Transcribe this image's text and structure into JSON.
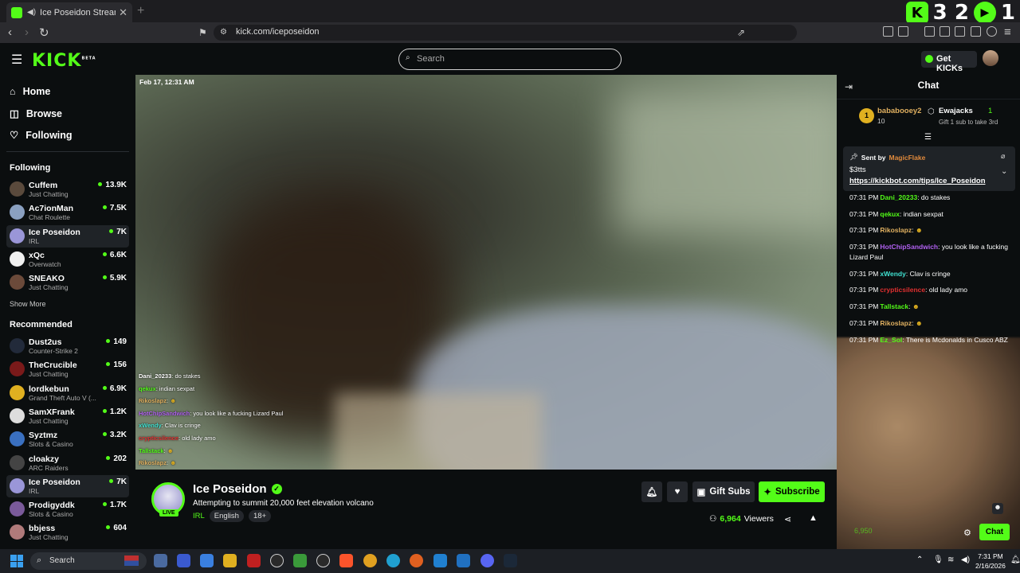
{
  "browser": {
    "tab_title": "Ice Poseidon Stream - Watch",
    "url": "kick.com/iceposeidon",
    "overlay": {
      "left_count": "3 2",
      "right_count": "1"
    }
  },
  "header": {
    "logo": "KICK",
    "logo_badge": "BETA",
    "search_placeholder": "Search",
    "get_kicks": "Get KICKs"
  },
  "sidebar": {
    "nav": [
      {
        "label": "Home",
        "icon": "home-icon"
      },
      {
        "label": "Browse",
        "icon": "compass-icon"
      },
      {
        "label": "Following",
        "icon": "heart-icon"
      }
    ],
    "following_title": "Following",
    "following": [
      {
        "name": "Cuffem",
        "category": "Just Chatting",
        "viewers": "13.9K",
        "color": "#5a4a3c"
      },
      {
        "name": "Ac7ionMan",
        "category": "Chat Roulette",
        "viewers": "7.5K",
        "color": "#8aa0c0"
      },
      {
        "name": "Ice Poseidon",
        "category": "IRL",
        "viewers": "7K",
        "color": "#9a96d8"
      },
      {
        "name": "xQc",
        "category": "Overwatch",
        "viewers": "6.6K",
        "color": "#f0f0f0"
      },
      {
        "name": "SNEAKO",
        "category": "Just Chatting",
        "viewers": "5.9K",
        "color": "#6b4a3a"
      }
    ],
    "show_more": "Show More",
    "recommended_title": "Recommended",
    "recommended": [
      {
        "name": "Dust2us",
        "category": "Counter-Strike 2",
        "viewers": "149",
        "color": "#222a3a"
      },
      {
        "name": "TheCrucible",
        "category": "Just Chatting",
        "viewers": "156",
        "color": "#7a1a1a"
      },
      {
        "name": "lordkebun",
        "category": "Grand Theft Auto V (...",
        "viewers": "6.9K",
        "color": "#e0b020"
      },
      {
        "name": "SamXFrank",
        "category": "Just Chatting",
        "viewers": "1.2K",
        "color": "#dddddd"
      },
      {
        "name": "Syztmz",
        "category": "Slots & Casino",
        "viewers": "3.2K",
        "color": "#3a70c0"
      },
      {
        "name": "cloakzy",
        "category": "ARC Raiders",
        "viewers": "202",
        "color": "#444444"
      },
      {
        "name": "Ice Poseidon",
        "category": "IRL",
        "viewers": "7K",
        "color": "#9a96d8"
      },
      {
        "name": "Prodigyddk",
        "category": "Slots & Casino",
        "viewers": "1.7K",
        "color": "#7a5a9a"
      },
      {
        "name": "bbjess",
        "category": "Just Chatting",
        "viewers": "604",
        "color": "#b07a7a"
      }
    ]
  },
  "video": {
    "timestamp": "Feb 17, 12:31 AM",
    "overlay_chat": [
      {
        "user": "Dani_20233",
        "text": "do stakes",
        "color": "#ffffff"
      },
      {
        "user": "qekux",
        "text": "indian sexpat",
        "color": "#53fc18"
      },
      {
        "user": "Rikoslapz",
        "text": "",
        "color": "#e0b060"
      },
      {
        "user": "HotChipSandwich",
        "text": "you look like a fucking Lizard Paul",
        "color": "#b060f0"
      },
      {
        "user": "xWendy",
        "text": "Clav is cringe",
        "color": "#40e0d0"
      },
      {
        "user": "crypticsilence",
        "text": "old lady amo",
        "color": "#e03030"
      },
      {
        "user": "Tallstack",
        "text": "",
        "color": "#53fc18"
      },
      {
        "user": "Rikoslapz",
        "text": "",
        "color": "#e0b060"
      }
    ]
  },
  "stream": {
    "channel": "Ice Poseidon",
    "live": "LIVE",
    "title": "Attempting to summit 20,000 feet elevation volcano",
    "category": "IRL",
    "tags": [
      "English",
      "18+"
    ],
    "gift_subs": "Gift Subs",
    "subscribe": "Subscribe",
    "viewers": "6,964",
    "viewers_label": "Viewers"
  },
  "chat": {
    "title": "Chat",
    "leaderboard": {
      "first_user": "bababooey2",
      "first_count": "10",
      "second_user": "Ewajacks",
      "second_count": "1",
      "gift_text": "Gift 1 sub to take 3rd"
    },
    "pinned": {
      "sent_by": "Sent by",
      "sender": "MagicFlake",
      "amount": "$3tts",
      "link": "https://kickbot.com/tips/Ice_Poseidon"
    },
    "messages": [
      {
        "time": "07:31 PM",
        "user": "Dani_20233",
        "text": "do stakes",
        "color": "#53fc18"
      },
      {
        "time": "07:31 PM",
        "user": "qekux",
        "text": "indian sexpat",
        "color": "#53fc18"
      },
      {
        "time": "07:31 PM",
        "user": "Rikoslapz",
        "text": "",
        "color": "#e0b060"
      },
      {
        "time": "07:31 PM",
        "user": "HotChipSandwich",
        "text": "you look like a fucking Lizard Paul",
        "color": "#b060f0"
      },
      {
        "time": "07:31 PM",
        "user": "xWendy",
        "text": "Clav is cringe",
        "color": "#40e0d0"
      },
      {
        "time": "07:31 PM",
        "user": "crypticsilence",
        "text": "old lady amo",
        "color": "#e03030"
      },
      {
        "time": "07:31 PM",
        "user": "Tallstack",
        "text": "",
        "color": "#53fc18"
      },
      {
        "time": "07:31 PM",
        "user": "Rikoslapz",
        "text": "",
        "color": "#e0b060"
      },
      {
        "time": "07:31 PM",
        "user": "Ez_Sol",
        "text": "There is Mcdonalds in Cusco ABZ",
        "color": "#53fc18"
      }
    ],
    "send_button": "Chat",
    "points": "6,950"
  },
  "taskbar": {
    "search": "Search",
    "time": "7:31 PM",
    "date": "2/16/2026"
  }
}
